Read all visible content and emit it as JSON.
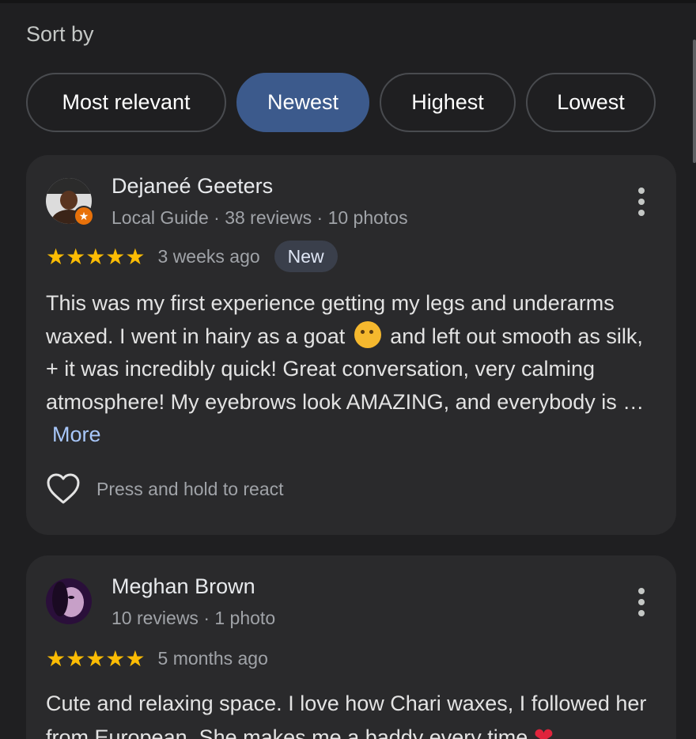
{
  "sort": {
    "label": "Sort by",
    "options": [
      "Most relevant",
      "Newest",
      "Highest",
      "Lowest"
    ],
    "selected": "Newest"
  },
  "colors": {
    "background": "#1f1f21",
    "card": "#2a2a2c",
    "active_chip": "#3c5a8c",
    "star": "#fbbc04",
    "link": "#a8c7fa",
    "local_guide_badge": "#e8710a"
  },
  "reviews": [
    {
      "author": "Dejaneé Geeters",
      "meta": "Local Guide · 38 reviews · 10 photos",
      "local_guide": true,
      "rating": 5,
      "stars": "★★★★★",
      "time": "3 weeks ago",
      "badge": "New",
      "text_before_emoji": "This was my first experience getting my legs and underarms waxed. I went in hairy as a goat",
      "emoji": "face-with-hand-over-mouth",
      "text_after_emoji": "and left out smooth as silk, + it was incredibly quick! Great conversation, very calming atmosphere! My eyebrows look AMAZING, and everybody is …",
      "more_label": "More",
      "react_label": "Press and hold to react"
    },
    {
      "author": "Meghan Brown",
      "meta": "10 reviews · 1 photo",
      "local_guide": false,
      "rating": 5,
      "stars": "★★★★★",
      "time": "5 months ago",
      "text_visible": "Cute and relaxing space. I love how Chari waxes, I followed her from European. She makes me a baddy every time",
      "emoji": "red-heart"
    }
  ]
}
